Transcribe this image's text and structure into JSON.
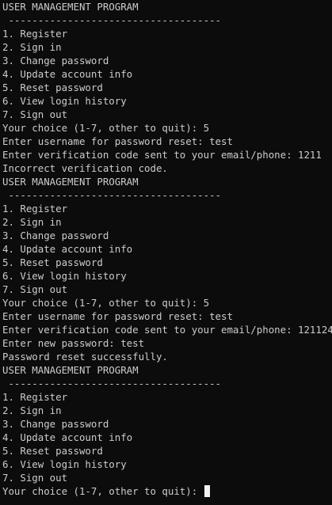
{
  "terminal": {
    "lines": [
      "USER MANAGEMENT PROGRAM",
      " ------------------------------------",
      "1. Register",
      "2. Sign in",
      "3. Change password",
      "4. Update account info",
      "5. Reset password",
      "6. View login history",
      "7. Sign out",
      "Your choice (1-7, other to quit): 5",
      "Enter username for password reset: test",
      "Enter verification code sent to your email/phone: 1211",
      "Incorrect verification code.",
      "USER MANAGEMENT PROGRAM",
      " ------------------------------------",
      "1. Register",
      "2. Sign in",
      "3. Change password",
      "4. Update account info",
      "5. Reset password",
      "6. View login history",
      "7. Sign out",
      "Your choice (1-7, other to quit): 5",
      "Enter username for password reset: test",
      "Enter verification code sent to your email/phone: 121124",
      "Enter new password: test",
      "Password reset successfully.",
      "USER MANAGEMENT PROGRAM",
      " ------------------------------------",
      "1. Register",
      "2. Sign in",
      "3. Change password",
      "4. Update account info",
      "5. Reset password",
      "6. View login history",
      "7. Sign out"
    ],
    "prompt": "Your choice (1-7, other to quit): "
  },
  "colors": {
    "background": "#0c0c0c",
    "text": "#cccccc",
    "cursor": "#f2f2f2"
  }
}
